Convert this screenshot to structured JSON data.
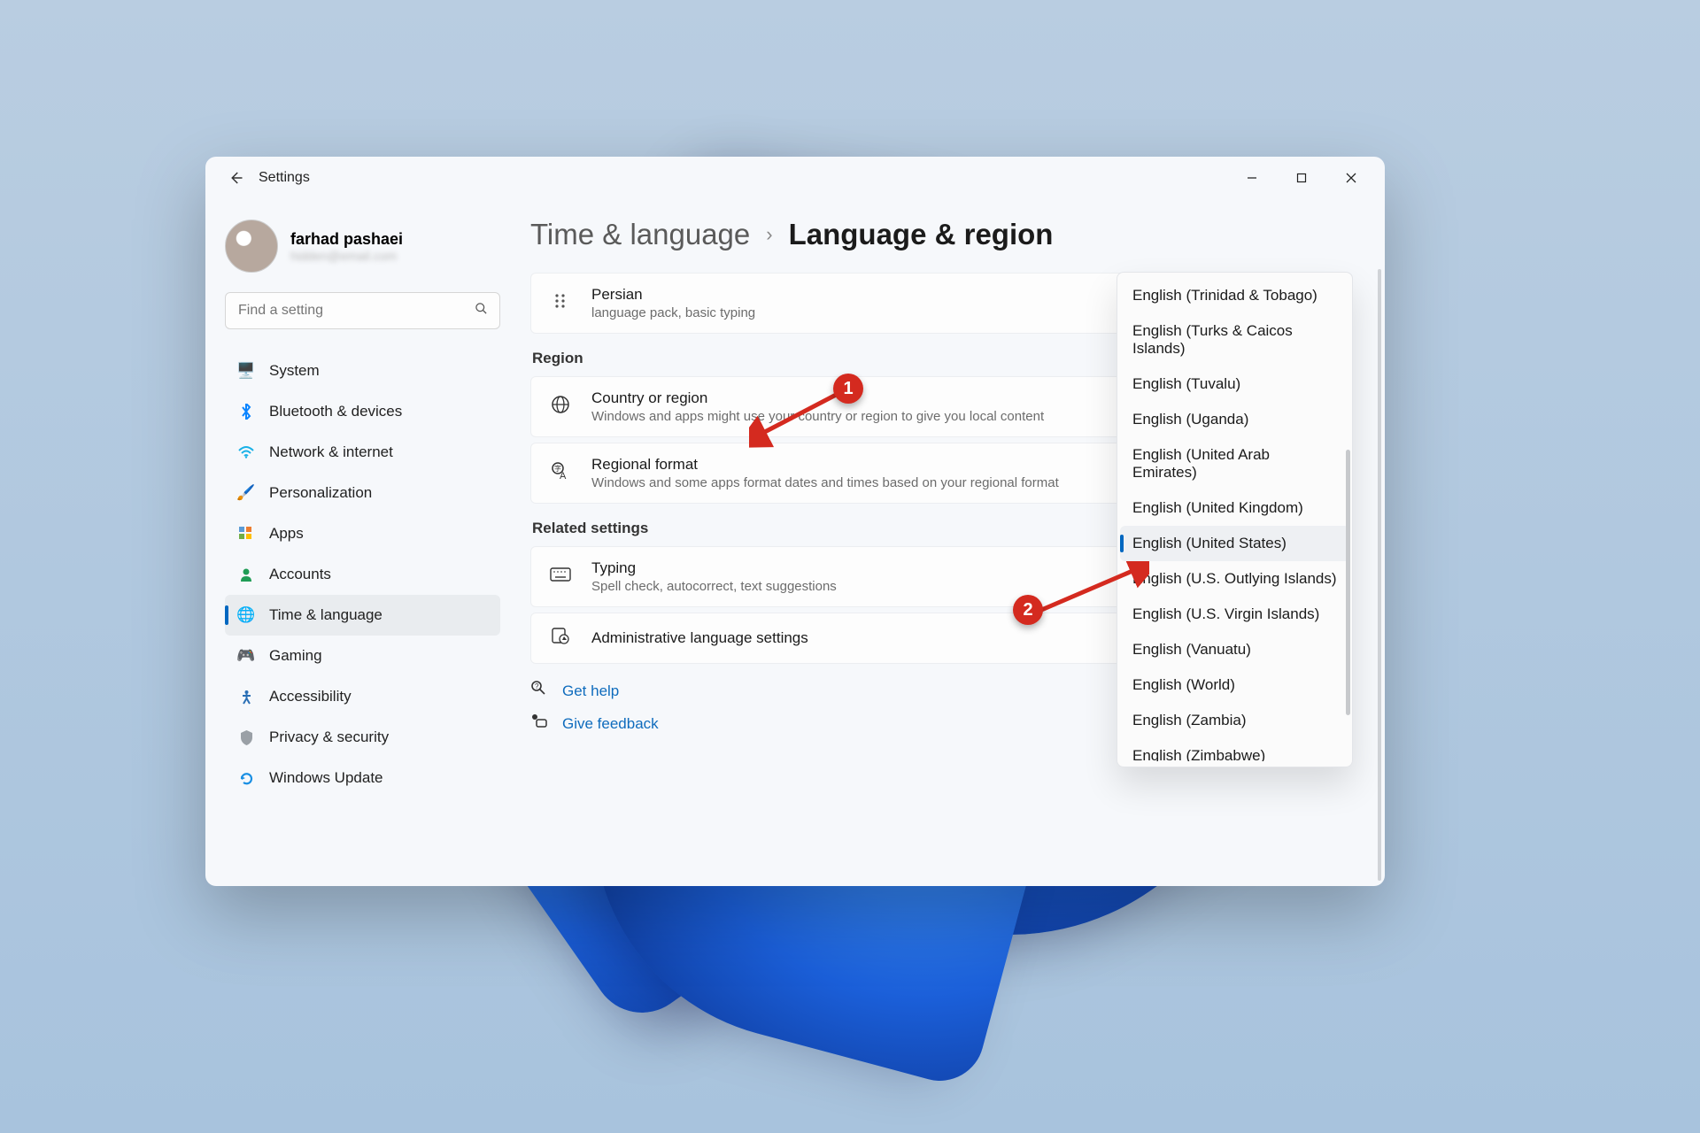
{
  "titlebar": {
    "app_name": "Settings"
  },
  "user": {
    "name": "farhad pashaei",
    "email": "hidden@email.com"
  },
  "search": {
    "placeholder": "Find a setting"
  },
  "sidebar": {
    "items": [
      {
        "label": "System"
      },
      {
        "label": "Bluetooth & devices"
      },
      {
        "label": "Network & internet"
      },
      {
        "label": "Personalization"
      },
      {
        "label": "Apps"
      },
      {
        "label": "Accounts"
      },
      {
        "label": "Time & language"
      },
      {
        "label": "Gaming"
      },
      {
        "label": "Accessibility"
      },
      {
        "label": "Privacy & security"
      },
      {
        "label": "Windows Update"
      }
    ]
  },
  "breadcrumb": {
    "parent": "Time & language",
    "current": "Language & region"
  },
  "language_card": {
    "title": "Persian",
    "subtitle": "language pack, basic typing"
  },
  "sections": {
    "region": "Region",
    "related": "Related settings"
  },
  "region_cards": {
    "country": {
      "title": "Country or region",
      "subtitle": "Windows and apps might use your country or region to give you local content"
    },
    "format": {
      "title": "Regional format",
      "subtitle": "Windows and some apps format dates and times based on your regional format"
    }
  },
  "related_cards": {
    "typing": {
      "title": "Typing",
      "subtitle": "Spell check, autocorrect, text suggestions"
    },
    "admin": {
      "title": "Administrative language settings"
    }
  },
  "help": {
    "get_help": "Get help",
    "feedback": "Give feedback"
  },
  "dropdown": {
    "items": [
      "English (Trinidad & Tobago)",
      "English (Turks & Caicos Islands)",
      "English (Tuvalu)",
      "English (Uganda)",
      "English (United Arab Emirates)",
      "English (United Kingdom)",
      "English (United States)",
      "English (U.S. Outlying Islands)",
      "English (U.S. Virgin Islands)",
      "English (Vanuatu)",
      "English (World)",
      "English (Zambia)",
      "English (Zimbabwe)"
    ],
    "selected_index": 6
  },
  "annotations": {
    "badge1": "1",
    "badge2": "2"
  }
}
